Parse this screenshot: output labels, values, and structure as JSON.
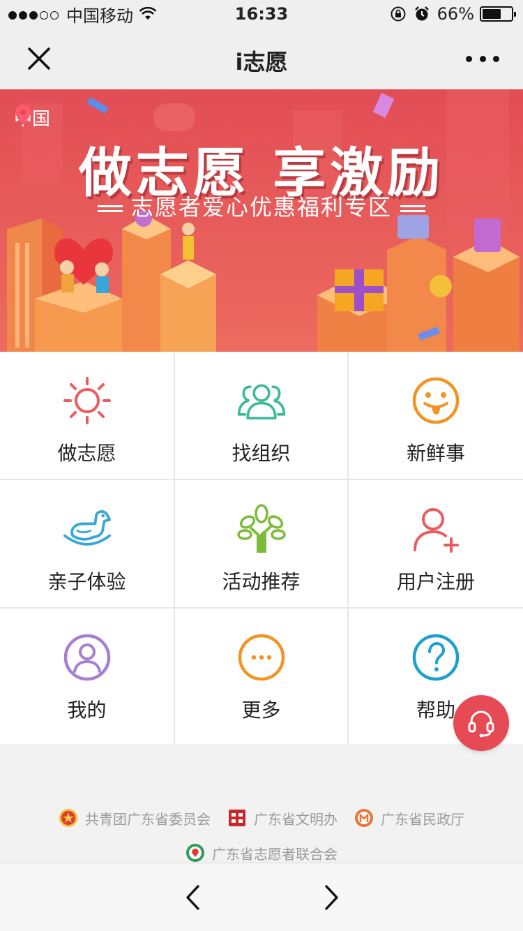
{
  "status_bar": {
    "carrier": "中国移动",
    "time": "16:33",
    "battery": "66%",
    "battery_level": 0.66
  },
  "nav": {
    "title": "i志愿"
  },
  "banner": {
    "location": "中国",
    "title": "做志愿 享激励",
    "subtitle": "志愿者爱心优惠福利专区"
  },
  "grid": [
    {
      "label": "做志愿",
      "icon": "sun-icon",
      "color": "#ec5b5f"
    },
    {
      "label": "找组织",
      "icon": "group-icon",
      "color": "#3cb89a"
    },
    {
      "label": "新鲜事",
      "icon": "smiley-icon",
      "color": "#f39422"
    },
    {
      "label": "亲子体验",
      "icon": "rocking-horse-icon",
      "color": "#3aa6d8"
    },
    {
      "label": "活动推荐",
      "icon": "tree-icon",
      "color": "#7dbb3a"
    },
    {
      "label": "用户注册",
      "icon": "add-user-icon",
      "color": "#ec5b5f"
    },
    {
      "label": "我的",
      "icon": "profile-icon",
      "color": "#a57fd0"
    },
    {
      "label": "更多",
      "icon": "more-icon",
      "color": "#f39422"
    },
    {
      "label": "帮助",
      "icon": "help-icon",
      "color": "#1aa0d1"
    }
  ],
  "sponsors": [
    {
      "name": "共青团广东省委员会",
      "logo": "youth-league-logo"
    },
    {
      "name": "广东省文明办",
      "logo": "civilization-office-logo"
    },
    {
      "name": "广东省民政厅",
      "logo": "civil-affairs-logo"
    },
    {
      "name": "广东省志愿者联合会",
      "logo": "volunteer-federation-logo"
    }
  ],
  "colors": {
    "banner_bg": "#e4525a",
    "support_button": "#e54a55"
  }
}
